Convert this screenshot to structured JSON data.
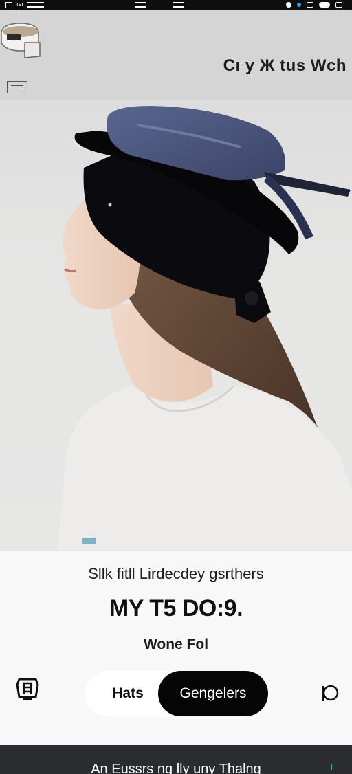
{
  "status_bar": {
    "left_text": "ısı",
    "icons": [
      "sim-icon",
      "menu-icon",
      "menu-icon",
      "location-icon",
      "wifi-icon",
      "battery-icon"
    ]
  },
  "hero": {
    "brand_title": "Cı y Ж tus Wch",
    "thumbnail_icon": "product-thumbnail-icon"
  },
  "product": {
    "subtitle": "Sllk fitll Lirdecdey gsrthers",
    "title": "MY T5 DO:9.",
    "meta": "Wone Fol"
  },
  "segmented_control": {
    "options": [
      {
        "label": "Hats",
        "selected": false
      },
      {
        "label": "Gengelers",
        "selected": true
      }
    ]
  },
  "icons": {
    "left": "store-icon",
    "right": "search-icon"
  },
  "bottom_banner": {
    "text": "An Eussrs ng lly uny Thalng"
  },
  "colors": {
    "accent": "#050505",
    "banner_bg": "#2a2c2f",
    "banner_indicator": "#1fb8c9",
    "hat_blue": "#4a5478"
  }
}
